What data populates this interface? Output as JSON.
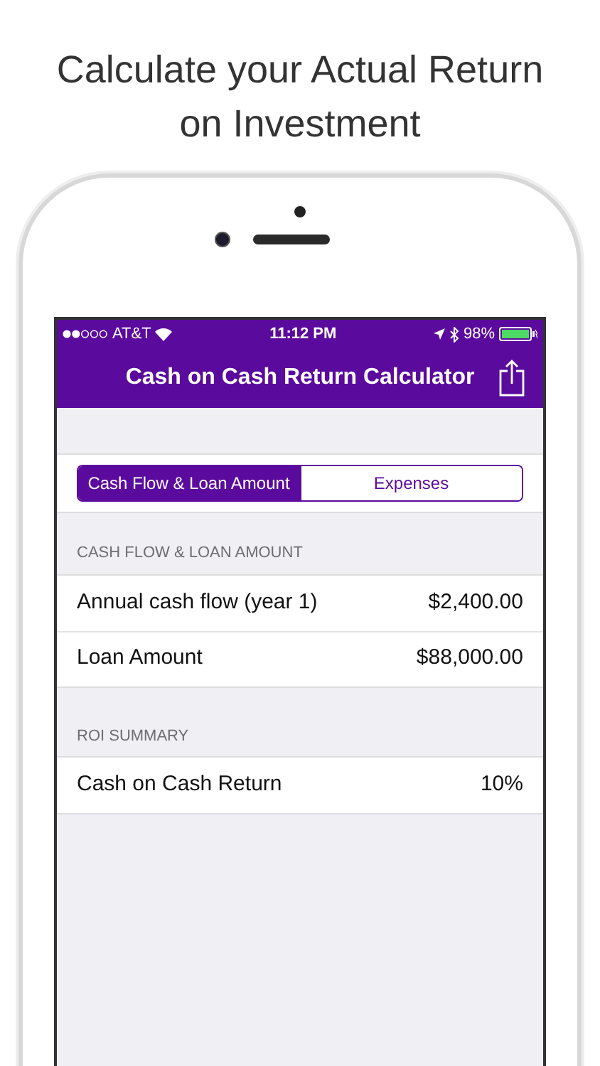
{
  "headline": "Calculate your Actual Return on Investment",
  "status_bar": {
    "carrier": "AT&T",
    "time": "11:12 PM",
    "battery": "98%"
  },
  "nav_bar": {
    "title": "Cash on Cash Return Calculator"
  },
  "segments": [
    {
      "label": "Cash Flow & Loan Amount",
      "selected": true
    },
    {
      "label": "Expenses",
      "selected": false
    }
  ],
  "sections": [
    {
      "header": "CASH FLOW & LOAN AMOUNT",
      "rows": [
        {
          "label": "Annual cash flow (year 1)",
          "value": "$2,400.00"
        },
        {
          "label": "Loan Amount",
          "value": "$88,000.00"
        }
      ]
    },
    {
      "header": "ROI SUMMARY",
      "rows": [
        {
          "label": "Cash on Cash Return",
          "value": "10%"
        }
      ]
    }
  ]
}
